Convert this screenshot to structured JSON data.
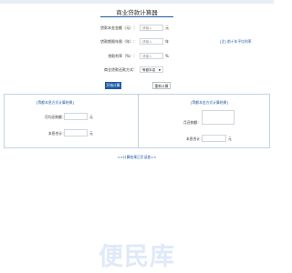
{
  "header": {
    "title": "商业贷款计算器"
  },
  "form": {
    "amount": {
      "label": "贷款本金金额（元）：",
      "placeholder": "请输入",
      "unit": "元"
    },
    "term": {
      "label": "贷款期限年限（年）：",
      "placeholder": "请输入",
      "unit": "年"
    },
    "rate": {
      "label": "贷款利率（%）：",
      "placeholder": "请输入",
      "unit": "%"
    },
    "method": {
      "label": "商业贷款还款方式：",
      "selected": "等额本息"
    },
    "side_link": "[注] 前十年平均利率"
  },
  "buttons": {
    "calculate": "开始计算",
    "reset": "重新计算"
  },
  "results": {
    "left": {
      "title": "[等额本息方式计算结果]",
      "monthly_label": "月均还款额：",
      "monthly_unit": "元",
      "total_label": "本息合计：",
      "total_unit": "元"
    },
    "right": {
      "title": "[等额本金方式计算结果]",
      "monthly_label": "月还款额：",
      "total_label": "本息合计：",
      "total_unit": "元"
    }
  },
  "footer": {
    "link": "<<计算结果正负误差>>"
  },
  "watermark": "便民库"
}
